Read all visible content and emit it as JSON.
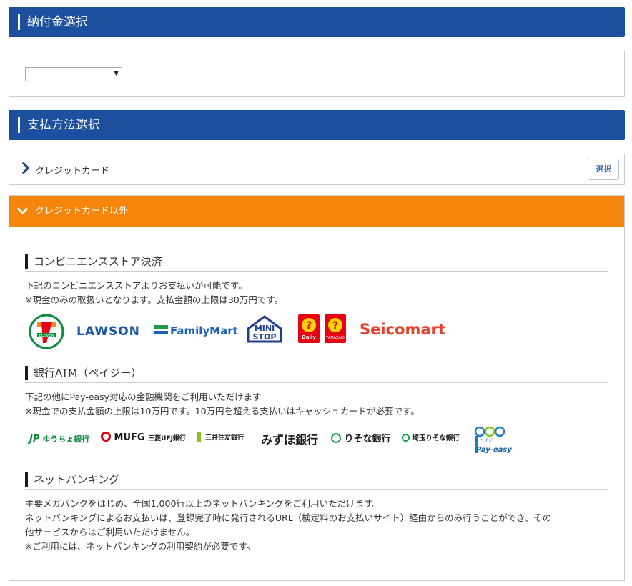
{
  "section1": {
    "title": "納付金選択",
    "select_value": ""
  },
  "section2": {
    "title": "支払方法選択"
  },
  "accordion_credit": {
    "label": "クレジットカード",
    "button_label": "選択"
  },
  "accordion_other": {
    "label": "クレジットカード以外"
  },
  "convenience": {
    "title": "コンビニエンスストア決済",
    "line1": "下記のコンビニエンスストアよりお支払いが可能です。",
    "line2": "※現金のみの取扱いとなります。支払金額の上限は30万円です。",
    "logos": {
      "seven": "ELEVEN",
      "lawson": "LAWSON",
      "familymart": "FamilyMart",
      "ministop_1": "MINI",
      "ministop_2": "STOP",
      "daily": "Daily",
      "daily_sub": "YAMAZAKI",
      "seicomart": "Seicomart"
    }
  },
  "atm": {
    "title": "銀行ATM（ペイジー）",
    "line1": "下記の他にPay-easy対応の金融機関をご利用いただけます",
    "line2": "※現金での支払金額の上限は10万円です。10万円を超える支払いはキャッシュカードが必要です。",
    "logos": {
      "yucho": "ゆうちょ銀行",
      "mufg": "MUFG",
      "mufg_sub": "三菱UFJ銀行",
      "smbc": "三井住友銀行",
      "mizuho": "みずほ銀行",
      "resona": "りそな銀行",
      "saitama": "埼玉りそな銀行",
      "payeasy": "Pay-easy",
      "payeasy_sub": "ペイジー"
    }
  },
  "netbank": {
    "title": "ネットバンキング",
    "line1": "主要メガバンクをはじめ、全国1,000行以上のネットバンキングをご利用いただけます。",
    "line2": "ネットバンキングによるお支払いは、登録完了時に発行されるURL（検定料のお支払いサイト）経由からのみ行うことができ、その",
    "line3": "他サービスからはご利用いただけません。",
    "line4": "※ご利用には、ネットバンキングの利用契約が必要です。"
  },
  "colors": {
    "header_blue": "#1c4f9e",
    "accordion_orange": "#f5860b"
  },
  "icons": {
    "collapsed": "chevron-right-icon",
    "expanded": "chevron-down-icon",
    "select_arrow": "caret-down-icon"
  }
}
